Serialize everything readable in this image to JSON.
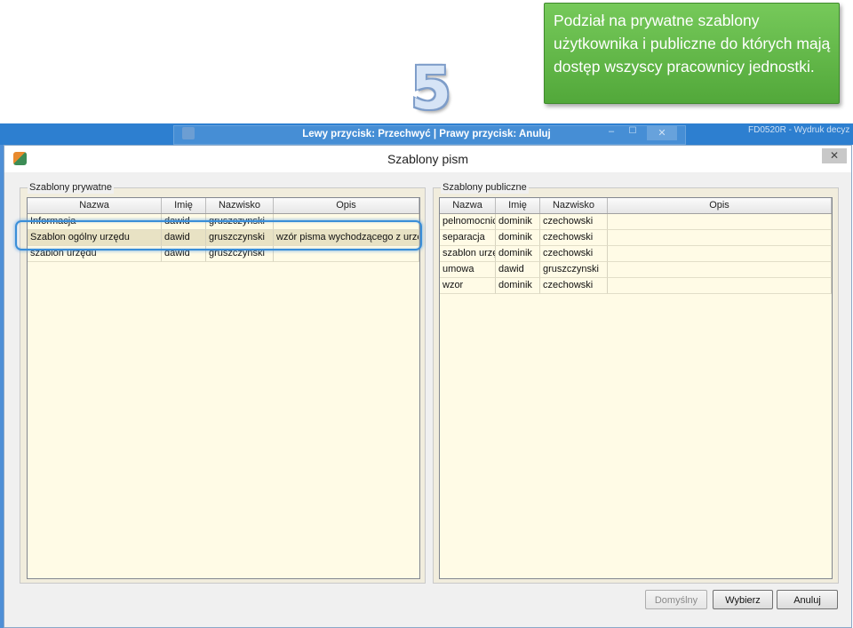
{
  "callout": {
    "text": "Podział na prywatne szablony użytkownika i publiczne do których mają dostęp wszyscy pracownicy jednostki."
  },
  "step_number": "5",
  "capture_bar": {
    "text": "Lewy przycisk: Przechwyć | Prawy przycisk: Anuluj",
    "background_caption": "FD0520R - Wydruk decyz",
    "ghost_close": "✕",
    "ghost_min": "–",
    "ghost_max": "☐"
  },
  "dialog": {
    "title": "Szablony pism",
    "close_glyph": "✕",
    "private_group": {
      "legend": "Szablony prywatne",
      "columns": [
        "Nazwa",
        "Imię",
        "Nazwisko",
        "Opis"
      ],
      "rows": [
        {
          "nazwa": "Informacja",
          "imie": "dawid",
          "nazwisko": "gruszczynski",
          "opis": ""
        },
        {
          "nazwa": "Szablon ogólny urzędu",
          "imie": "dawid",
          "nazwisko": "gruszczynski",
          "opis": "wzór pisma wychodzącego z urzędu"
        },
        {
          "nazwa": "szablon urzędu",
          "imie": "dawid",
          "nazwisko": "gruszczynski",
          "opis": ""
        }
      ],
      "selected_row": 1
    },
    "public_group": {
      "legend": "Szablony publiczne",
      "columns": [
        "Nazwa",
        "Imię",
        "Nazwisko",
        "Opis"
      ],
      "rows": [
        {
          "nazwa": "pelnomocnictwo",
          "imie": "dominik",
          "nazwisko": "czechowski",
          "opis": ""
        },
        {
          "nazwa": "separacja",
          "imie": "dominik",
          "nazwisko": "czechowski",
          "opis": ""
        },
        {
          "nazwa": "szablon urzędu",
          "imie": "dominik",
          "nazwisko": "czechowski",
          "opis": ""
        },
        {
          "nazwa": "umowa",
          "imie": "dawid",
          "nazwisko": "gruszczynski",
          "opis": ""
        },
        {
          "nazwa": "wzor",
          "imie": "dominik",
          "nazwisko": "czechowski",
          "opis": ""
        }
      ]
    },
    "buttons": {
      "default": "Domyślny",
      "select": "Wybierz",
      "cancel": "Anuluj"
    }
  },
  "colors": {
    "callout_green": "#5cb043",
    "capture_blue": "#2d7fd0",
    "grid_background": "#fffbe6",
    "focus_blue": "#3a8ed8"
  }
}
